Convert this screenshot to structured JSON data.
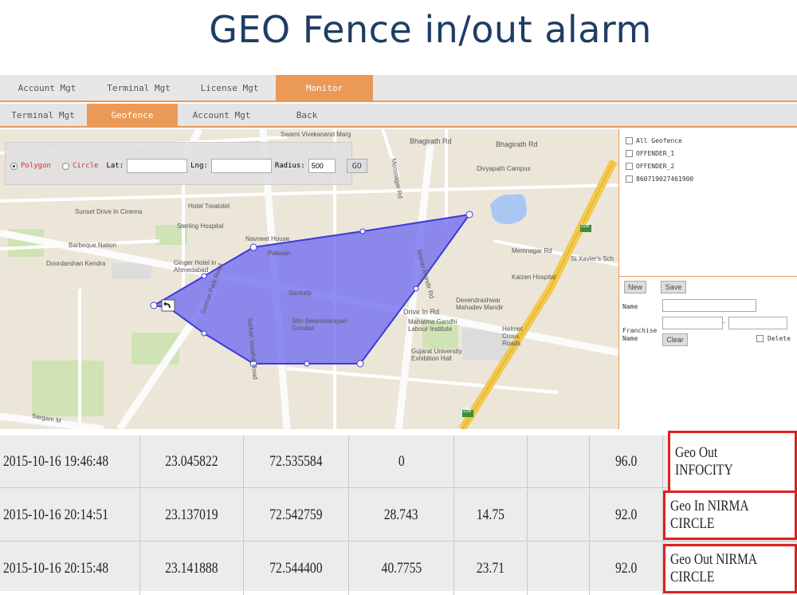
{
  "title": "GEO Fence in/out alarm",
  "nav_top": [
    "Account Mgt",
    "Terminal Mgt",
    "License Mgt",
    "Monitor"
  ],
  "nav_sub": [
    "Terminal Mgt",
    "Geofence",
    "Account Mgt",
    "Back"
  ],
  "toolbar": {
    "polygon": "Polygon",
    "circle": "Circle",
    "lat_label": "Lat:",
    "lat_value": "",
    "lng_label": "Lng:",
    "lng_value": "",
    "radius_label": "Radius:",
    "radius_value": "500",
    "go": "GO"
  },
  "map_labels": {
    "sunset": "Sunset Drive In Cinema",
    "treatotel": "Hotel Treatotel",
    "sterling": "Sterling Hospital",
    "barbeque": "Barbeque Nation",
    "doordarshan": "Doordarshan Kendra",
    "ginger": "Ginger Hotel in Ahmedabad",
    "navneet": "Navneet House",
    "pakwan": "Pakwan",
    "sankalp": "Sankalp",
    "gurukul": "Shri Swaminarayan Gurukul",
    "bhagirath1": "Bhagirath Rd",
    "bhagirath2": "Bhagirath Rd",
    "vivekanand": "Swami Vivekanand Marg",
    "divyapath": "Divyapath Campus",
    "memnagar": "Memnagar Rd",
    "xavier": "St Xavier's Sch",
    "kaizen": "Kaizen Hospital",
    "devendra": "Devendrashwar Mahadev Mandir",
    "gandhi": "Mahatma Gandhi Labour Institute",
    "helmet": "Helmet Cross Roads",
    "gujarat": "Gujarat University Exhibition Hall",
    "drivein": "Drive In Rd",
    "manav": "Manav Mandir Rd",
    "sargam": "Sargam M",
    "sunrise": "Sunrise Park Road",
    "sarkari": "Sarkari Vasahat Road",
    "memnagar_v": "Memnagar Rd",
    "route1": "228",
    "route2": "228"
  },
  "fences": [
    "All Geofence",
    "OFFENDER_1",
    "OFFENDER_2",
    "860719027461900"
  ],
  "side_form": {
    "new": "New",
    "save": "Save",
    "name_label": "Name",
    "franchise_label": "Franchise Name",
    "dash": "-",
    "clear": "Clear",
    "delete": "Delete"
  },
  "rows": [
    {
      "time": "2015-10-16 19:46:48",
      "lat": "23.045822",
      "lng": "72.535584",
      "c4": "0",
      "c5": "",
      "c6": "",
      "c7": "96.0",
      "status": "Geo Out INFOCITY"
    },
    {
      "time": "2015-10-16 20:14:51",
      "lat": "23.137019",
      "lng": "72.542759",
      "c4": "28.743",
      "c5": "14.75",
      "c6": "",
      "c7": "92.0",
      "status": "Geo In NIRMA CIRCLE"
    },
    {
      "time": "2015-10-16 20:15:48",
      "lat": "23.141888",
      "lng": "72.544400",
      "c4": "40.7755",
      "c5": "23.71",
      "c6": "",
      "c7": "92.0",
      "status": "Geo Out NIRMA CIRCLE"
    }
  ],
  "colors": {
    "accent": "#ea9a56",
    "fence": "#6f6bf0",
    "alert": "#e02020",
    "title": "#1f3d63"
  }
}
